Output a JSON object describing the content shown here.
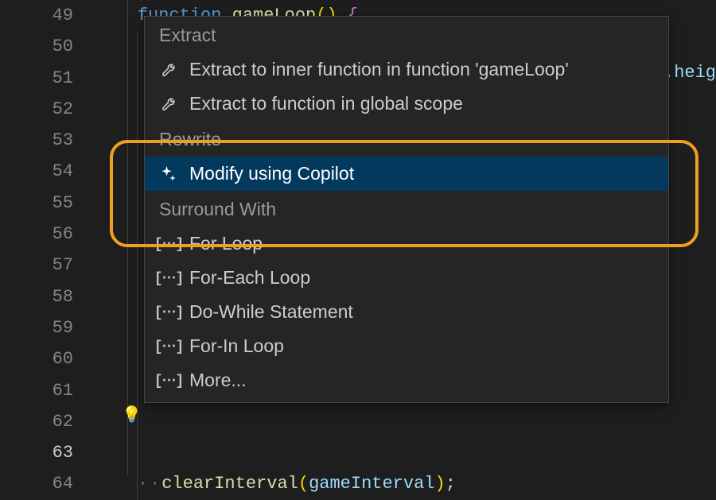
{
  "gutter": {
    "start": 49,
    "end": 64,
    "active": 63
  },
  "code": {
    "line49": {
      "kw": "function",
      "fn": "gameLoop",
      "parens": "()",
      "brace": " {"
    },
    "trail": {
      "dot": ".",
      "prop": "heig"
    },
    "line64_pre": "    ",
    "line64_dots": "··",
    "line64_fn": "clearInterval",
    "line64_paren_open": "(",
    "line64_arg": "gameInterval",
    "line64_paren_close": ")",
    "line64_semi": ";"
  },
  "bulb": "💡",
  "popup": {
    "sections": {
      "extract": "Extract",
      "rewrite": "Rewrite",
      "surround": "Surround With"
    },
    "items": {
      "extract_inner": "Extract to inner function in function 'gameLoop'",
      "extract_global": "Extract to function in global scope",
      "modify_copilot": "Modify using Copilot",
      "for_loop": "For Loop",
      "foreach_loop": "For-Each Loop",
      "dowhile": "Do-While Statement",
      "forin": "For-In Loop",
      "more": "More..."
    },
    "snippet_glyph": "[⋯]"
  }
}
